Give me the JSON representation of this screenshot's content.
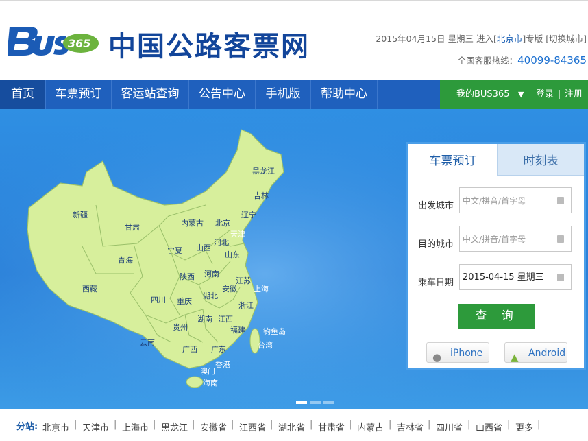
{
  "header": {
    "logo_text": "Bus365",
    "site_title": "中国公路客票网",
    "date": "2015年04月15日 星期三",
    "enter_prefix": "进入[",
    "current_city": "北京市",
    "enter_suffix": "]专版",
    "switch_city": "[切换城市]",
    "hotline_label": "全国客服热线：",
    "hotline_number": "40099-84365"
  },
  "nav": {
    "items": [
      "首页",
      "车票预订",
      "客运站查询",
      "公告中心",
      "手机版",
      "帮助中心"
    ],
    "member": "我的BUS365",
    "login": "登录",
    "register": "注册"
  },
  "map": {
    "provinces": [
      "黑龙江",
      "吉林",
      "辽宁",
      "内蒙古",
      "北京",
      "天津",
      "新疆",
      "甘肃",
      "宁夏",
      "山西",
      "河北",
      "山东",
      "青海",
      "陕西",
      "河南",
      "江苏",
      "西藏",
      "四川",
      "重庆",
      "湖北",
      "安徽",
      "上海",
      "浙江",
      "湖南",
      "江西",
      "贵州",
      "福建",
      "云南",
      "广西",
      "广东",
      "台湾",
      "香港",
      "澳门",
      "海南",
      "钓鱼岛"
    ]
  },
  "booking": {
    "tab_book": "车票预订",
    "tab_timetable": "时刻表",
    "from_label": "出发城市",
    "from_placeholder": "中文/拼音/首字母",
    "to_label": "目的城市",
    "to_placeholder": "中文/拼音/首字母",
    "date_label": "乘车日期",
    "date_value": "2015-04-15 星期三",
    "search_button": "查 询",
    "iphone": "iPhone",
    "android": "Android"
  },
  "branches": {
    "label": "分站:",
    "items": [
      "北京市",
      "天津市",
      "上海市",
      "黑龙江",
      "安徽省",
      "江西省",
      "湖北省",
      "甘肃省",
      "内蒙古",
      "吉林省",
      "四川省",
      "山西省",
      "更多"
    ]
  }
}
